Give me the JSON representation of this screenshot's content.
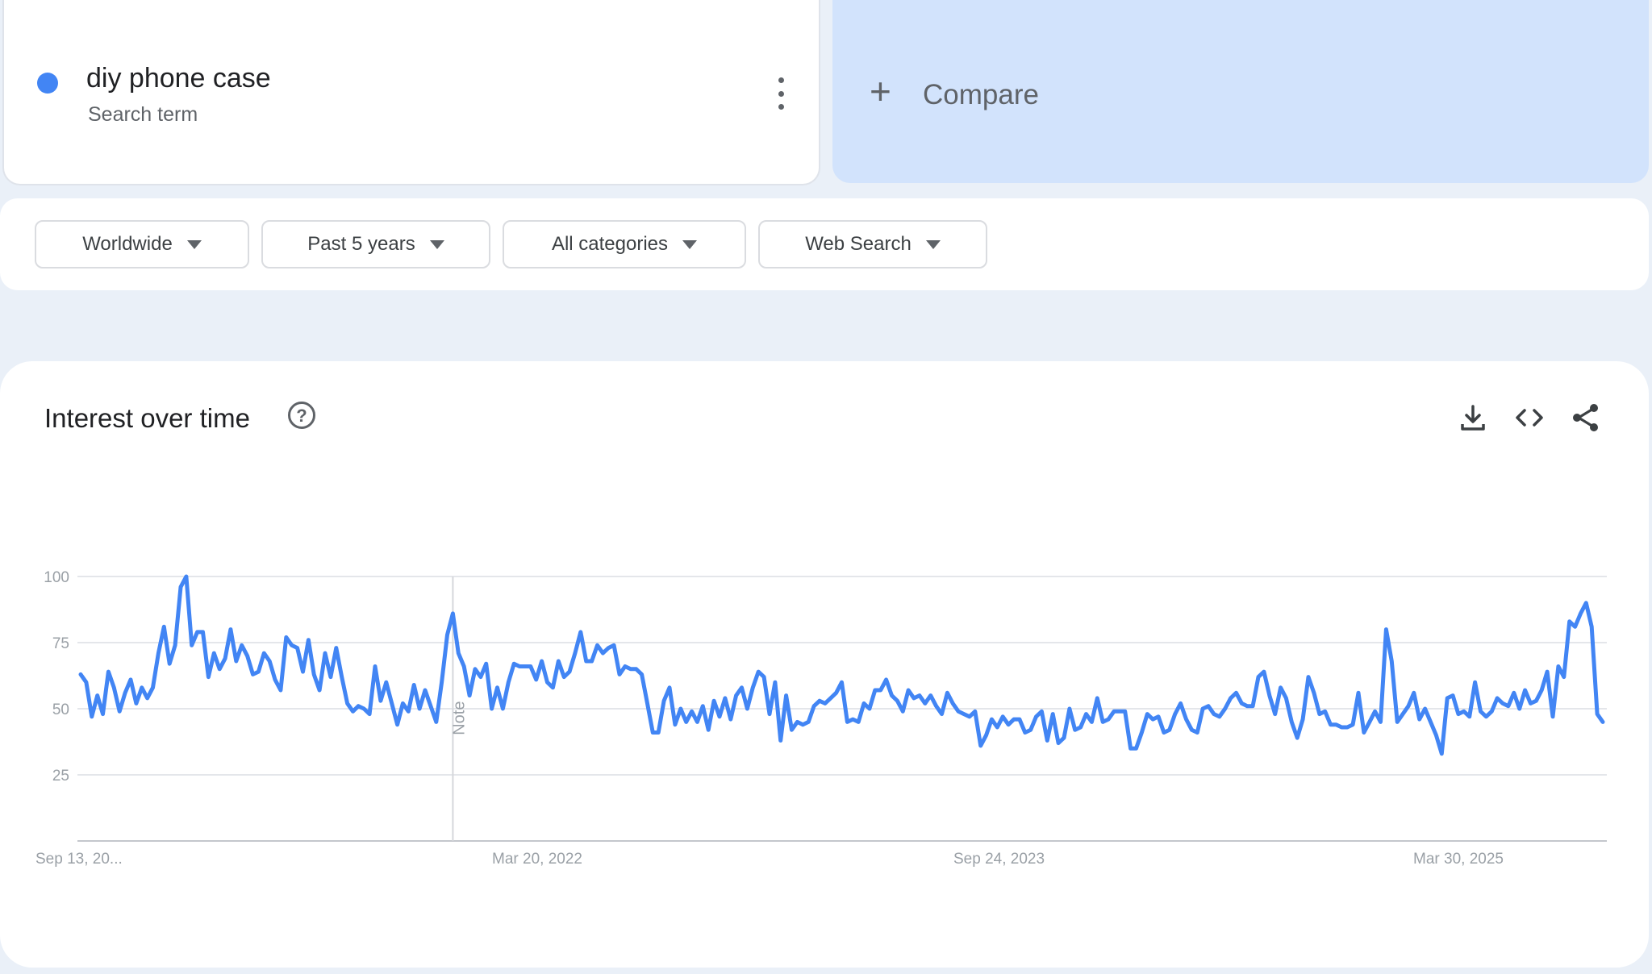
{
  "term": {
    "name": "diy phone case",
    "type": "Search term",
    "color": "#4285f4"
  },
  "compare": {
    "label": "Compare"
  },
  "filters": [
    {
      "label": "Worldwide"
    },
    {
      "label": "Past 5 years"
    },
    {
      "label": "All categories"
    },
    {
      "label": "Web Search"
    }
  ],
  "chart": {
    "title": "Interest over time",
    "help_icon": "help-circle-icon",
    "tools": [
      "download-icon",
      "embed-code-icon",
      "share-icon"
    ]
  },
  "chart_data": {
    "type": "line",
    "title": "",
    "xlabel": "",
    "ylabel": "",
    "ylim": [
      0,
      100
    ],
    "y_ticks": [
      25,
      50,
      75,
      100
    ],
    "x_tick_labels": [
      "Sep 13, 20...",
      "Mar 20, 2022",
      "Sep 24, 2023",
      "Mar 30, 2025"
    ],
    "annotation": "Note",
    "grid": true,
    "legend": "none",
    "series": [
      {
        "color": "#4285f4",
        "values": [
          63,
          60,
          47,
          55,
          48,
          64,
          58,
          49,
          56,
          61,
          52,
          58,
          54,
          58,
          71,
          81,
          67,
          74,
          96,
          100,
          74,
          79,
          79,
          62,
          71,
          65,
          69,
          80,
          68,
          74,
          70,
          63,
          64,
          71,
          68,
          61,
          57,
          77,
          74,
          73,
          64,
          76,
          63,
          57,
          71,
          62,
          73,
          62,
          52,
          49,
          51,
          50,
          48,
          66,
          53,
          60,
          52,
          44,
          52,
          49,
          59,
          50,
          57,
          51,
          45,
          60,
          78,
          86,
          71,
          66,
          55,
          65,
          62,
          67,
          50,
          58,
          50,
          60,
          67,
          66,
          66,
          66,
          61,
          68,
          60,
          58,
          68,
          62,
          64,
          71,
          79,
          68,
          68,
          74,
          71,
          73,
          74,
          63,
          66,
          65,
          65,
          63,
          52,
          41,
          41,
          53,
          58,
          44,
          50,
          45,
          49,
          45,
          51,
          42,
          53,
          47,
          54,
          46,
          55,
          58,
          50,
          58,
          64,
          62,
          48,
          60,
          38,
          55,
          42,
          45,
          44,
          45,
          51,
          53,
          52,
          54,
          56,
          60,
          45,
          46,
          45,
          52,
          50,
          57,
          57,
          61,
          55,
          53,
          49,
          57,
          54,
          55,
          52,
          55,
          51,
          48,
          56,
          52,
          49,
          48,
          47,
          49,
          36,
          40,
          46,
          43,
          47,
          44,
          46,
          46,
          41,
          42,
          47,
          49,
          38,
          48,
          37,
          39,
          50,
          42,
          43,
          48,
          45,
          54,
          45,
          46,
          49,
          49,
          49,
          35,
          35,
          41,
          48,
          46,
          47,
          41,
          42,
          48,
          52,
          46,
          42,
          41,
          50,
          51,
          48,
          47,
          50,
          54,
          56,
          52,
          51,
          51,
          62,
          64,
          55,
          48,
          58,
          54,
          45,
          39,
          46,
          62,
          56,
          48,
          49,
          44,
          44,
          43,
          43,
          44,
          56,
          41,
          45,
          49,
          45,
          80,
          68,
          45,
          48,
          51,
          56,
          46,
          50,
          45,
          40,
          33,
          54,
          55,
          48,
          49,
          47,
          60,
          49,
          47,
          49,
          54,
          52,
          51,
          56,
          50,
          57,
          52,
          53,
          57,
          64,
          47,
          66,
          62,
          83,
          81,
          86,
          90,
          81,
          48,
          45
        ]
      }
    ]
  }
}
